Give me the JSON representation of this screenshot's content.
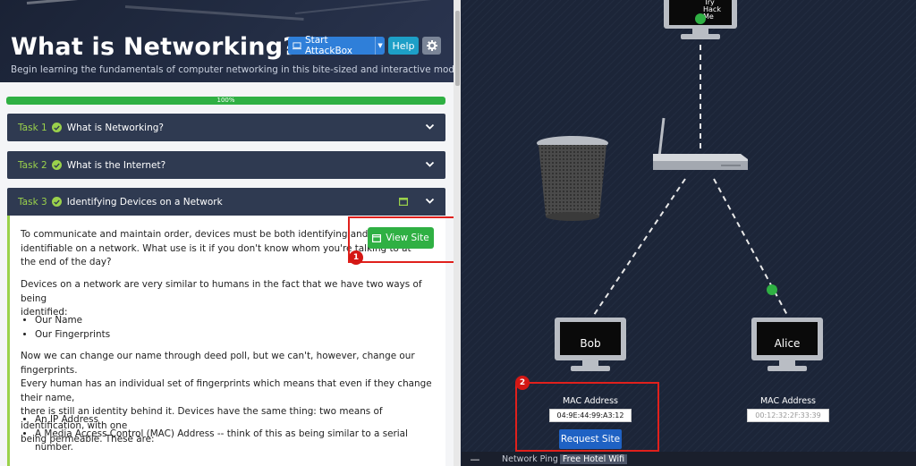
{
  "header": {
    "title": "What is Networking?",
    "subtitle": "Begin learning the fundamentals of computer networking in this bite-sized and interactive module.",
    "attackbox_label": "Start AttackBox",
    "help_label": "Help"
  },
  "progress": {
    "label": "100%",
    "value": 1.0,
    "color": "#2fb043"
  },
  "tasks": [
    {
      "number": "Task 1",
      "name": "What is Networking?"
    },
    {
      "number": "Task 2",
      "name": "What is the Internet?"
    },
    {
      "number": "Task 3",
      "name": "Identifying Devices on a Network"
    }
  ],
  "task3_content": {
    "view_site_label": "View Site",
    "para1_lines": [
      "To communicate and maintain order, devices must be both identifying and",
      "identifiable on a network. What use is it if you don't know whom you're talking to at",
      "the end of the day?"
    ],
    "para2_lines": [
      "Devices on a network are very similar to humans in the fact that we have two ways of being",
      "identified:"
    ],
    "bullets1": [
      "Our Name",
      "Our Fingerprints"
    ],
    "para3_lines": [
      "Now we can change our name through deed poll, but we can't, however, change our fingerprints.",
      "Every human has an individual set of fingerprints which means that even if they change their name,",
      "there is still an identity behind it. Devices have the same thing: two means of identification, with one",
      "being permeable. These are:"
    ],
    "bullets2": [
      "An IP Address",
      "A Media Access Control (MAC) Address -- think of this as being similar to a serial number."
    ]
  },
  "annotations": {
    "one": "1",
    "two": "2"
  },
  "network": {
    "top_monitor_text": "Try\nHack\nMe",
    "bob": {
      "name": "Bob",
      "mac_caption": "MAC Address",
      "mac_value": "04:9E:44:99:A3:12"
    },
    "alice": {
      "name": "Alice",
      "mac_caption": "MAC Address",
      "mac_value": "00:12:32:2F:33:39"
    },
    "request_site_label": "Request Site"
  },
  "bottom_bar": {
    "minimize": "—",
    "ping": "Network Ping",
    "wifi": "Free Hotel Wifi"
  },
  "colors": {
    "accent_green": "#9ad14b",
    "button_green": "#2fb043",
    "annotation_red": "#e0201c",
    "header_bg": "#2f3a51"
  },
  "icons": [
    "monitor-icon",
    "chevron-down-icon",
    "check-circle-icon",
    "gear-icon",
    "window-icon",
    "trash-bin-icon",
    "router-icon"
  ]
}
